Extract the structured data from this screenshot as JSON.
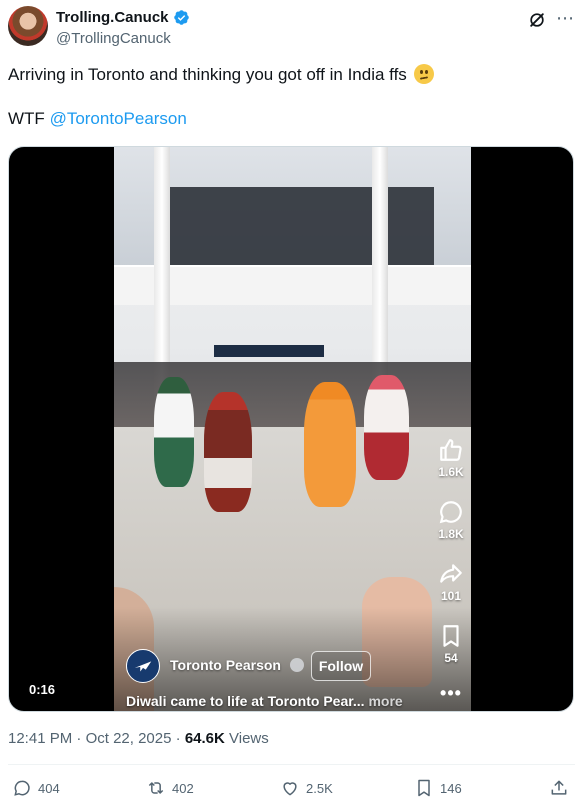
{
  "author": {
    "display_name": "Trolling.Canuck",
    "handle": "@TrollingCanuck",
    "verified": true,
    "verified_color": "#1d9bf0"
  },
  "tweet": {
    "text_line1": "Arriving in Toronto and thinking you got off in India ffs",
    "text_line2_prefix": "WTF",
    "mention": "@TorontoPearson",
    "emoji": "woozy-face"
  },
  "video": {
    "account_name": "Toronto Pearson",
    "follow_label": "Follow",
    "caption": "Diwali came to life at Toronto Pear...",
    "caption_more": "more",
    "timer": "0:16",
    "side_actions": [
      {
        "icon": "thumbs-up-icon",
        "count": "1.6K"
      },
      {
        "icon": "comment-icon",
        "count": "1.8K"
      },
      {
        "icon": "share-icon",
        "count": "101"
      },
      {
        "icon": "bookmark-icon",
        "count": "54"
      }
    ]
  },
  "meta": {
    "time": "12:41 PM",
    "separator": "·",
    "date": "Oct 22, 2025",
    "views_count": "64.6K",
    "views_label": "Views"
  },
  "actions": {
    "replies": "404",
    "reposts": "402",
    "likes": "2.5K",
    "bookmarks": "146"
  },
  "colors": {
    "text": "#0f1419",
    "secondary": "#536471",
    "link": "#1d9bf0"
  }
}
